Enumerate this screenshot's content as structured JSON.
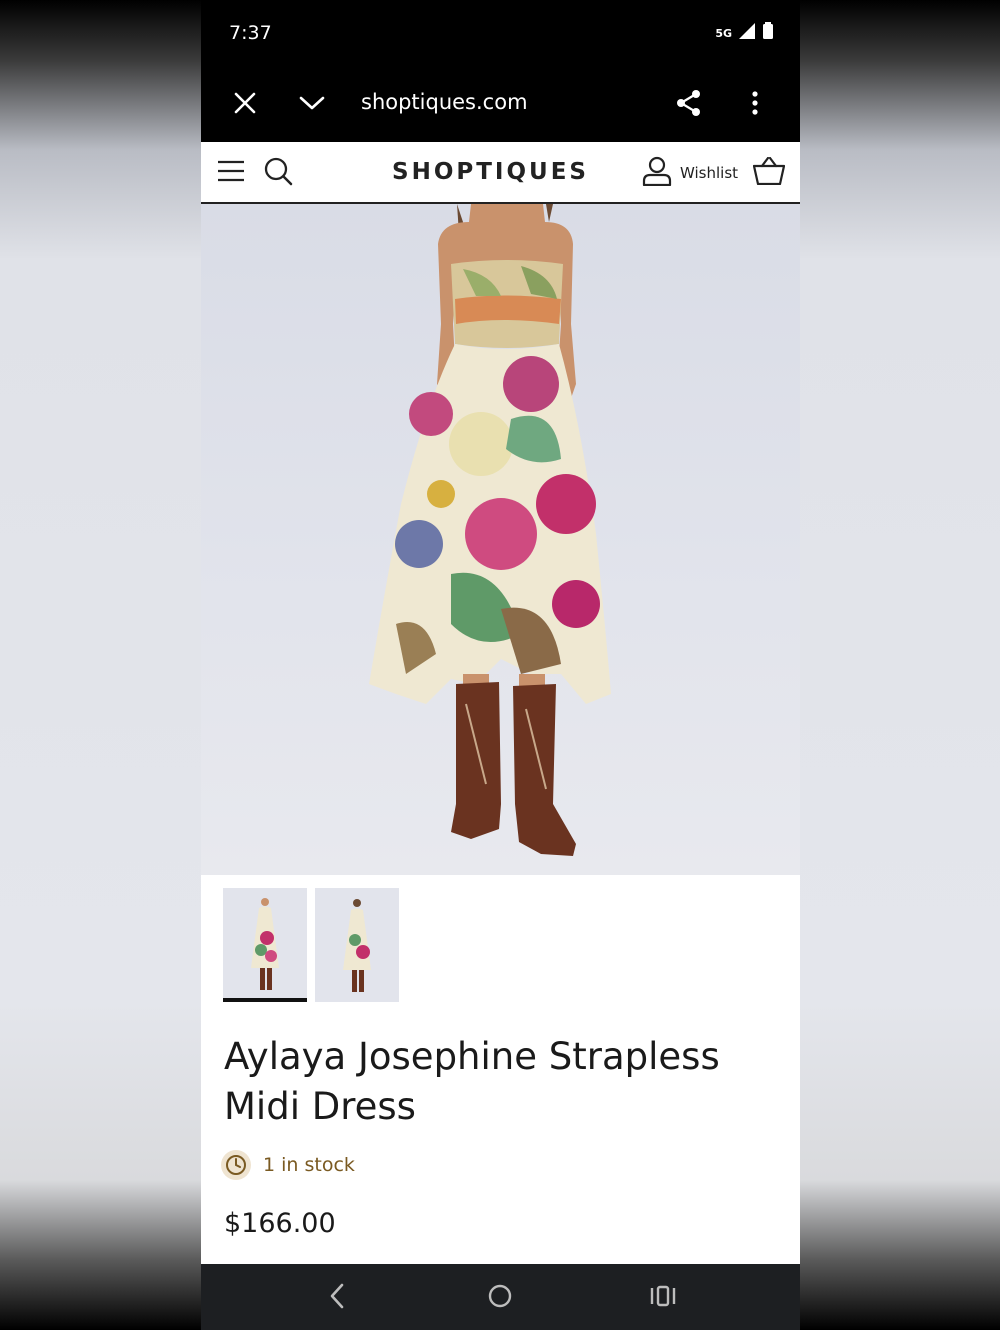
{
  "status_bar": {
    "time": "7:37",
    "network": "5G",
    "icons": [
      "signal-icon",
      "battery-icon"
    ]
  },
  "browser": {
    "url": "shoptiques.com",
    "icons": [
      "close-icon",
      "chevron-down-icon",
      "share-icon",
      "more-vert-icon"
    ]
  },
  "site_header": {
    "logo": "SHOPTIQUES",
    "wishlist_label": "Wishlist",
    "icons": [
      "menu-icon",
      "search-icon",
      "account-icon",
      "basket-icon"
    ]
  },
  "product": {
    "image_alt": "Model wearing floral strapless midi dress with brown western boots",
    "thumbnails": [
      {
        "label": "front view",
        "active": true
      },
      {
        "label": "back view",
        "active": false
      }
    ],
    "title": "Aylaya Josephine Strapless Midi Dress",
    "stock": "1 in stock",
    "price": "$166.00"
  },
  "colors": {
    "stock_text": "#7a5a22",
    "stock_icon_bg": "#efe4d1",
    "nav_bar": "#1d1f22"
  },
  "nav_bar": {
    "icons": [
      "back-icon",
      "home-icon",
      "recents-icon"
    ]
  }
}
